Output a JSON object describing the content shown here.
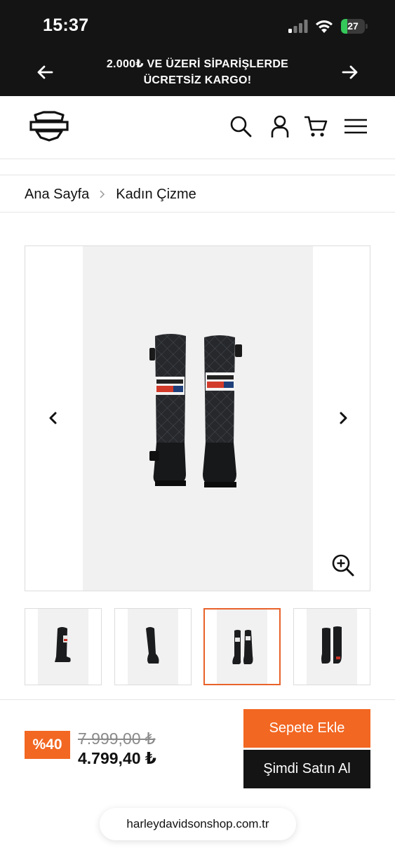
{
  "status_bar": {
    "time": "15:37",
    "battery_level": "27",
    "battery_fraction": 0.27,
    "icons": [
      "signal-icon",
      "wifi-icon",
      "battery-icon"
    ]
  },
  "promo": {
    "line1": "2.000₺ VE ÜZERİ SİPARİŞLERDE",
    "line2": "ÜCRETSİZ KARGO!"
  },
  "header": {
    "icons": [
      "harley-logo",
      "search-icon",
      "user-icon",
      "cart-icon",
      "menu-icon"
    ]
  },
  "breadcrumb": {
    "home": "Ana Sayfa",
    "current": "Kadın Çizme"
  },
  "gallery": {
    "thumbnails": 4,
    "active_index": 2
  },
  "pricing": {
    "discount": "%40",
    "old_price": "7.999,00 ₺",
    "new_price": "4.799,40 ₺"
  },
  "actions": {
    "add_to_cart": "Sepete Ekle",
    "buy_now": "Şimdi Satın Al"
  },
  "browser": {
    "url": "harleydavidsonshop.com.tr"
  },
  "colors": {
    "accent": "#f26722",
    "dark": "#141414",
    "battery": "#34c759"
  }
}
